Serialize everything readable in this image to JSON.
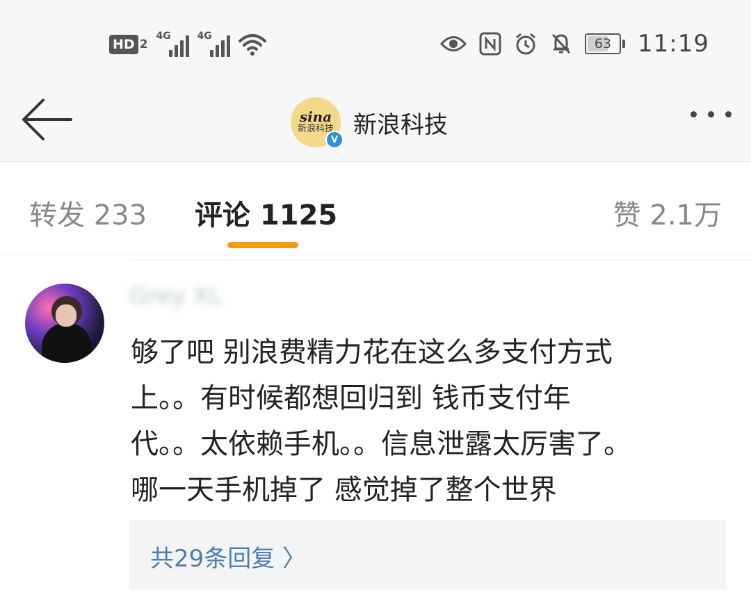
{
  "status_bar": {
    "hd_label": "HD",
    "hd_sim": "2",
    "sim1_label": "4G",
    "sim2_label": "4G",
    "battery": "63",
    "time": "11:19",
    "icons": [
      "hd-icon",
      "signal-icon",
      "signal-icon",
      "wifi-icon",
      "eye-icon",
      "nfc-icon",
      "alarm-icon",
      "mute-icon",
      "battery-icon"
    ]
  },
  "header": {
    "title": "新浪科技",
    "logo_text": "sina",
    "logo_sub": "新浪科技",
    "verified_mark": "V"
  },
  "tabs": [
    {
      "label": "转发 233"
    },
    {
      "label": "评论 1125"
    },
    {
      "label": "赞 2.1万"
    }
  ],
  "comment": {
    "username": "Grey XL",
    "lines": [
      "够了吧 别浪费精力花在这么多支付方式",
      "上。。有时候都想回归到 钱币支付年",
      "代。。太依赖手机。。信息泄露太厉害了。",
      "哪一天手机掉了  感觉掉了整个世界"
    ],
    "replies_label": "共29条回复 〉"
  },
  "colors": {
    "accent": "#f39c12",
    "link": "#4a7eb0",
    "verified": "#2f8fdd"
  }
}
